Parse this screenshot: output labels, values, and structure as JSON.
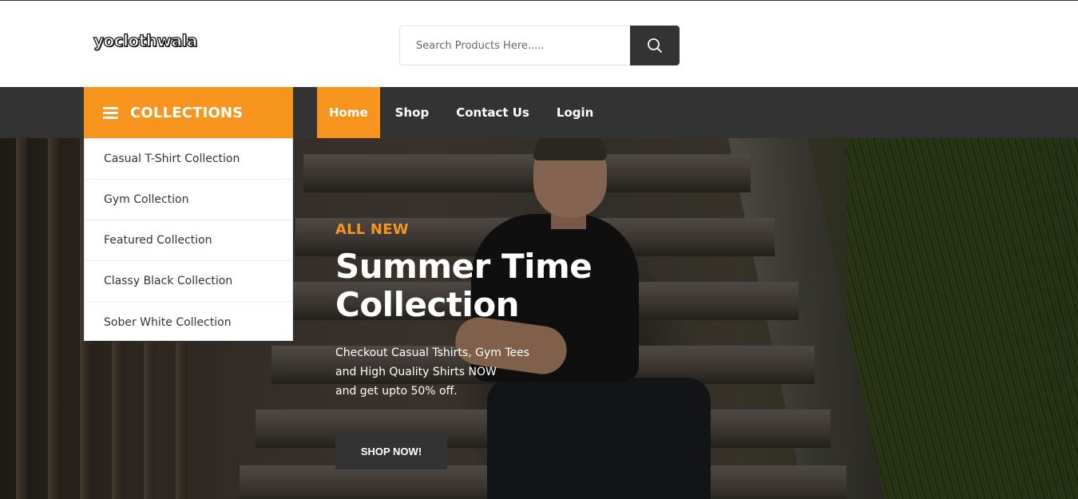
{
  "header": {
    "logo_text": "yoclothwala",
    "search": {
      "placeholder": "Search Products Here.....",
      "value": "",
      "button_icon": "search-icon"
    }
  },
  "nav": {
    "collections_label": "COLLECTIONS",
    "collections_icon": "hamburger-menu-icon",
    "links": [
      {
        "label": "Home",
        "active": true
      },
      {
        "label": "Shop",
        "active": false
      },
      {
        "label": "Contact Us",
        "active": false
      },
      {
        "label": "Login",
        "active": false
      }
    ]
  },
  "collections_menu": [
    "Casual T-Shirt Collection",
    "Gym Collection",
    "Featured Collection",
    "Classy Black Collection",
    "Sober White Collection"
  ],
  "hero": {
    "kicker": "ALL NEW",
    "title": "Summer Time\nCollection",
    "description": "Checkout Casual Tshirts, Gym Tees\nand High Quality Shirts NOW\nand get upto 50% off.",
    "cta_label": "SHOP NOW!"
  },
  "colors": {
    "accent": "#f7941d",
    "dark": "#333333",
    "white": "#ffffff"
  }
}
